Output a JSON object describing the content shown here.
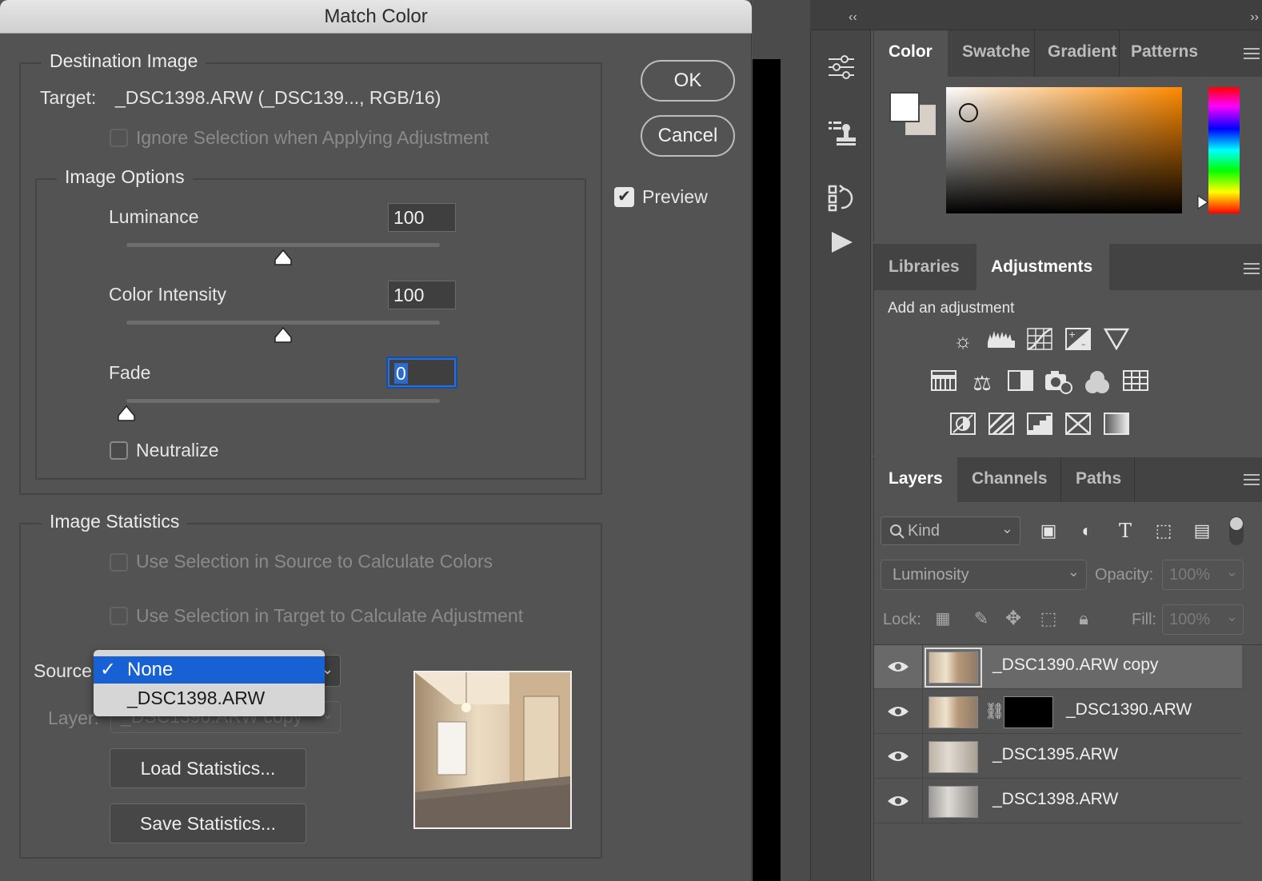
{
  "dialog": {
    "title": "Match Color",
    "destination": {
      "legend": "Destination Image",
      "target_label": "Target:",
      "target_value": "_DSC1398.ARW (_DSC139..., RGB/16)",
      "ignore_selection": "Ignore Selection when Applying Adjustment"
    },
    "image_options": {
      "legend": "Image Options",
      "luminance_label": "Luminance",
      "luminance_value": "100",
      "luminance_level": 0.5,
      "intensity_label": "Color Intensity",
      "intensity_value": "100",
      "intensity_level": 0.5,
      "fade_label": "Fade",
      "fade_value": "0",
      "fade_level": 0,
      "neutralize_label": "Neutralize"
    },
    "statistics": {
      "legend": "Image Statistics",
      "use_source_selection": "Use Selection in Source to Calculate Colors",
      "use_target_selection": "Use Selection in Target to Calculate Adjustment",
      "source_label": "Source",
      "source_options": [
        "None",
        "_DSC1398.ARW"
      ],
      "source_selected": "None",
      "layer_label": "Layer:",
      "layer_value": "_DSC1390.ARW copy",
      "load_button": "Load Statistics...",
      "save_button": "Save Statistics..."
    },
    "buttons": {
      "ok": "OK",
      "cancel": "Cancel",
      "preview": "Preview"
    }
  },
  "panels": {
    "collapse_left": "‹‹",
    "collapse_right": "››",
    "color_tabs": [
      "Color",
      "Swatches",
      "Gradient",
      "Patterns"
    ],
    "adjust_tabs": [
      "Libraries",
      "Adjustments"
    ],
    "add_adjustment": "Add an adjustment",
    "adjustment_icons": [
      [
        "brightness-contrast-icon",
        "levels-icon",
        "curves-icon",
        "exposure-icon",
        "vibrance-icon"
      ],
      [
        "hue-saturation-icon",
        "color-balance-icon",
        "black-white-icon",
        "photo-filter-icon",
        "channel-mixer-icon",
        "color-lookup-icon"
      ],
      [
        "invert-icon",
        "posterize-icon",
        "threshold-icon",
        "selective-color-icon",
        "gradient-map-icon"
      ]
    ],
    "layer_tabs": [
      "Layers",
      "Channels",
      "Paths"
    ],
    "kind_label": "Kind",
    "blend_mode": "Luminosity",
    "opacity_label": "Opacity:",
    "opacity_value": "100%",
    "lock_label": "Lock:",
    "fill_label": "Fill:",
    "fill_value": "100%",
    "layers": [
      "_DSC1390.ARW copy",
      "_DSC1390.ARW",
      "_DSC1395.ARW",
      "_DSC1398.ARW"
    ]
  },
  "colors": {
    "accent": "#1861d4",
    "foreground_swatch": "#ffffff",
    "background_swatch": "#d8cfc6"
  }
}
